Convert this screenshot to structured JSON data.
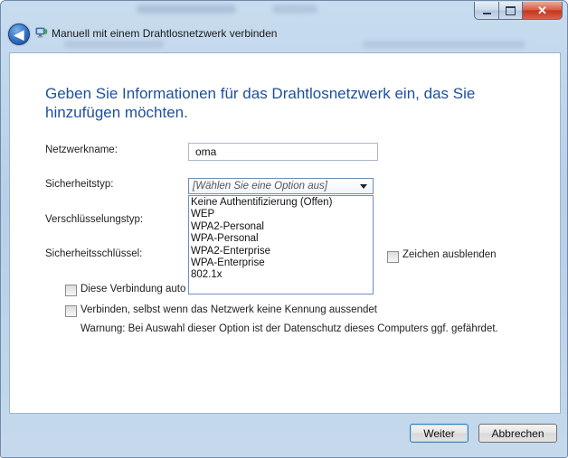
{
  "window": {
    "title": "Manuell mit einem Drahtlosnetzwerk verbinden",
    "caption_buttons": {
      "minimize": "minimize",
      "maximize": "maximize",
      "close": "✕"
    },
    "back_icon": "back-arrow-icon",
    "network_icon": "wireless-network-icon"
  },
  "form": {
    "heading": "Geben Sie Informationen für das Drahtlosnetzwerk ein, das Sie hinzufügen möchten.",
    "network_name": {
      "label": "Netzwerkname:",
      "value": "oma"
    },
    "security_type": {
      "label": "Sicherheitstyp:",
      "selected": "[Wählen Sie eine Option aus]",
      "options": [
        "Keine Authentifizierung (Offen)",
        "WEP",
        "WPA2-Personal",
        "WPA-Personal",
        "WPA2-Enterprise",
        "WPA-Enterprise",
        "802.1x"
      ]
    },
    "encryption_type": {
      "label": "Verschlüsselungstyp:"
    },
    "security_key": {
      "label": "Sicherheitsschlüssel:",
      "hide_chars_label": "Zeichen ausblenden"
    },
    "auto_connect": {
      "label": "Diese Verbindung auto",
      "checked": false
    },
    "hidden_network": {
      "label": "Verbinden, selbst wenn das Netzwerk keine Kennung aussendet",
      "checked": false
    },
    "warning": "Warnung: Bei Auswahl dieser Option ist der Datenschutz dieses Computers ggf. gefährdet."
  },
  "footer": {
    "next_label": "Weiter",
    "cancel_label": "Abbrechen"
  },
  "colors": {
    "heading": "#1f4f9b",
    "frame": "#b7cfe8",
    "close_button": "#c2341b"
  }
}
